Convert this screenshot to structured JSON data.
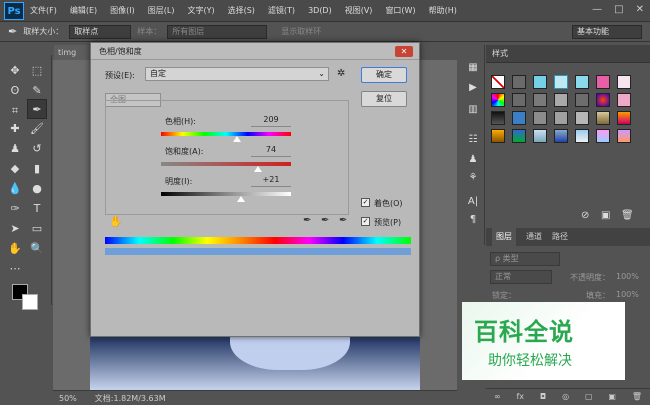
{
  "app": {
    "logo": "Ps"
  },
  "menu": [
    "文件(F)",
    "编辑(E)",
    "图像(I)",
    "图层(L)",
    "文字(Y)",
    "选择(S)",
    "滤镜(T)",
    "3D(D)",
    "视图(V)",
    "窗口(W)",
    "帮助(H)"
  ],
  "window_controls": [
    "—",
    "□",
    "✕"
  ],
  "options": {
    "sample_label": "取样大小：",
    "sample_value": "取样点",
    "sample2_label": "样本：",
    "sample2_value": "所有图层",
    "ring_label": "显示取样环",
    "workspace": "基本功能"
  },
  "document": {
    "tab": "timg (2).jp",
    "zoom": "50%",
    "doc_info": "文档:1.82M/3.63M"
  },
  "dialog": {
    "title": "色相/饱和度",
    "preset_label": "预设(E):",
    "preset_value": "自定",
    "ok": "确定",
    "reset": "复位",
    "channel": "全图",
    "hue_label": "色相(H):",
    "hue_value": "209",
    "sat_label": "饱和度(A):",
    "sat_value": "74",
    "light_label": "明度(I):",
    "light_value": "+21",
    "colorize_label": "着色(O)",
    "preview_label": "预览(P)"
  },
  "styles_panel": {
    "title": "样式"
  },
  "layers_panel": {
    "tabs": [
      "图层",
      "通道",
      "路径"
    ],
    "kind": "ρ 类型",
    "blend": "正常",
    "opacity_label": "不透明度：",
    "opacity": "100%",
    "lock_label": "锁定：",
    "fill_label": "填充：",
    "fill": "100%"
  },
  "bottom_icons": [
    "∞",
    "fx",
    "◘",
    "◎",
    "▢",
    "▣",
    "🗑"
  ],
  "watermark": {
    "main": "百科全说",
    "sub": "助你轻松解决"
  }
}
